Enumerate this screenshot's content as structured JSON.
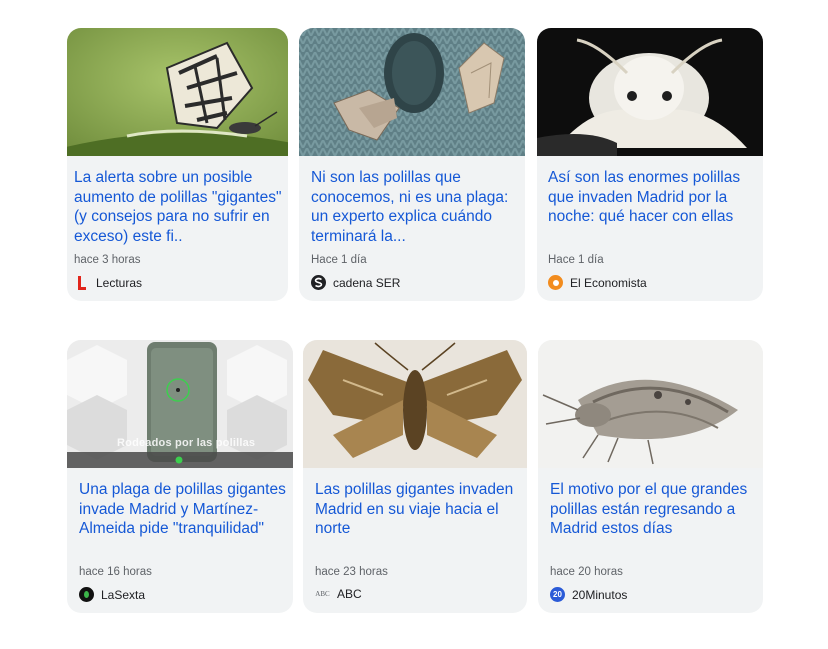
{
  "cards": [
    {
      "title": "La alerta sobre un posible aumento de polillas \"gigantes\" (y consejos para no sufrir en exceso) este fi..",
      "time": "hace 3 horas",
      "source": "Lecturas",
      "image": "butterfly-on-grass-photo",
      "logo": "lecturas-logo"
    },
    {
      "title": "Ni son las polillas que conocemos, ni es una plaga: un experto explica cuándo terminará la...",
      "time": "Hace 1 día",
      "source": "cadena SER",
      "image": "moths-on-knit-sweater-photo",
      "logo": "cadena-ser-logo"
    },
    {
      "title": "Así son las enormes polillas que invaden Madrid por la noche: qué hacer con ellas",
      "time": "Hace 1 día",
      "source": "El Economista",
      "image": "white-fluffy-moth-photo",
      "logo": "el-economista-logo"
    },
    {
      "title": "Una plaga de polillas gigantes invade Madrid y Martínez-Almeida pide \"tranquilidad\"",
      "time": "hace 16 horas",
      "source": "LaSexta",
      "image": "phone-video-thumbnail",
      "logo": "lasexta-logo",
      "overlay_text": "Rodeados por las polillas"
    },
    {
      "title": "Las polillas gigantes invaden Madrid en su viaje hacia el norte",
      "time": "hace 23 horas",
      "source": "ABC",
      "image": "brown-moth-spread-wings-photo",
      "logo": "abc-logo",
      "logo_text": "ABC"
    },
    {
      "title": "El motivo por el que grandes polillas están regresando a Madrid estos días",
      "time": "hace 20 horas",
      "source": "20Minutos",
      "image": "grey-moth-on-white-photo",
      "logo": "20minutos-logo",
      "logo_text": "20"
    }
  ],
  "colors": {
    "title": "#1558d6",
    "card_bg": "#f1f3f4",
    "meta": "#5f6368"
  }
}
